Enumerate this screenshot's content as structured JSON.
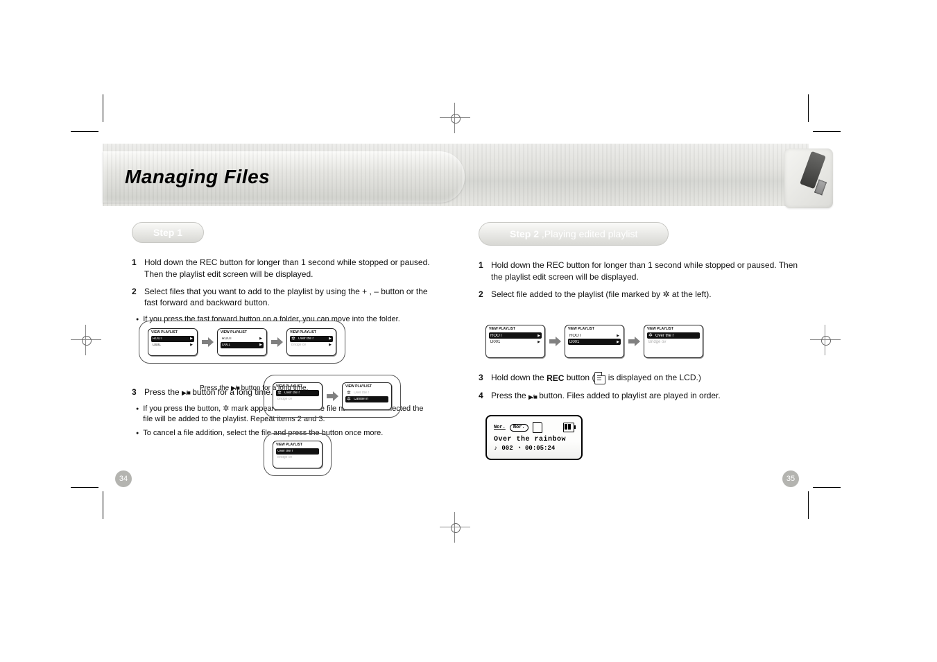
{
  "header": {
    "title": "Managing Files"
  },
  "left": {
    "step1_label": "Step 1",
    "intro": "Hold down the REC button for longer than 1 second while stopped or paused. Then the playlist edit screen will be displayed.",
    "step2_head": "2",
    "step2_text": "Select files that you want to add to the playlist by using the + , – button or the fast forward and backward button.",
    "note1": "If you press the fast forward button on a folder, you can move into the folder.",
    "step3_head": "3",
    "step3_text": "If you press the         button, ✲ mark appears in front of the file name. Once selected the file will be added to the playlist. Repeat items 2 and 3.",
    "pressbtn_pre": "Press the ",
    "pressbtn_post": " button for a long time.",
    "cancel": "To cancel a file addition, select the file and press the          button once more."
  },
  "right": {
    "step2_label": "Step 2  ",
    "step2_title_rest": ",Playing edited playlist",
    "r_step1_head": "1",
    "r_step1_text": "Hold down the REC button for longer than 1 second while stopped or paused. Then the playlist edit screen will be displayed.",
    "r_step2_head": "2",
    "r_step2_text": "Select file added to the playlist (file marked by ✲ at the left).",
    "r_step3_head": "3",
    "r_step3_pre": "Hold down the ",
    "r_step3_mid": " button (",
    "r_step3_post": " is displayed on the LCD.)",
    "r_step4_head": "4",
    "r_step4_pre": "Press the ",
    "r_step4_post": " button. Files added to playlist are played in order."
  },
  "lcd": {
    "topbar": "VIEW PLAYLIST",
    "root": "ROOT",
    "d001": "D001",
    "songA": "Over the r",
    "songB": "Bridge ov",
    "songC": "Candle in"
  },
  "player": {
    "nor1": "Nor.",
    "nor2": "Nor.",
    "track": "Over the rainbow",
    "idx": "002",
    "time": "00:05:24"
  },
  "pages": {
    "left": "34",
    "right": "35"
  }
}
